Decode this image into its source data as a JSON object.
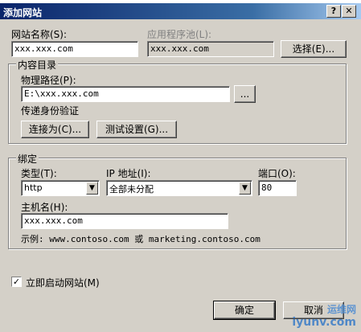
{
  "window": {
    "title": "添加网站",
    "help_glyph": "?",
    "close_glyph": "✕"
  },
  "site_name": {
    "label": "网站名称(S):",
    "value": "xxx.xxx.com"
  },
  "app_pool": {
    "label": "应用程序池(L):",
    "value": "xxx.xxx.com",
    "select_button": "选择(E)..."
  },
  "content_dir": {
    "group_title": "内容目录",
    "physical_path_label": "物理路径(P):",
    "physical_path_value": "E:\\xxx.xxx.com",
    "browse_button": "...",
    "passthrough_label": "传递身份验证",
    "connect_as_button": "连接为(C)...",
    "test_settings_button": "测试设置(G)..."
  },
  "binding": {
    "group_title": "绑定",
    "type_label": "类型(T):",
    "type_value": "http",
    "ip_label": "IP 地址(I):",
    "ip_value": "全部未分配",
    "port_label": "端口(O):",
    "port_value": "80",
    "hostname_label": "主机名(H):",
    "hostname_value": "xxx.xxx.com",
    "example_text": "示例: www.contoso.com 或 marketing.contoso.com"
  },
  "start_site": {
    "label": "立即启动网站(M)",
    "checked": true
  },
  "footer": {
    "ok_button": "确定",
    "cancel_button": "取消"
  },
  "watermark": {
    "top_text": "运维网",
    "bottom_text": "iyunv.com"
  }
}
